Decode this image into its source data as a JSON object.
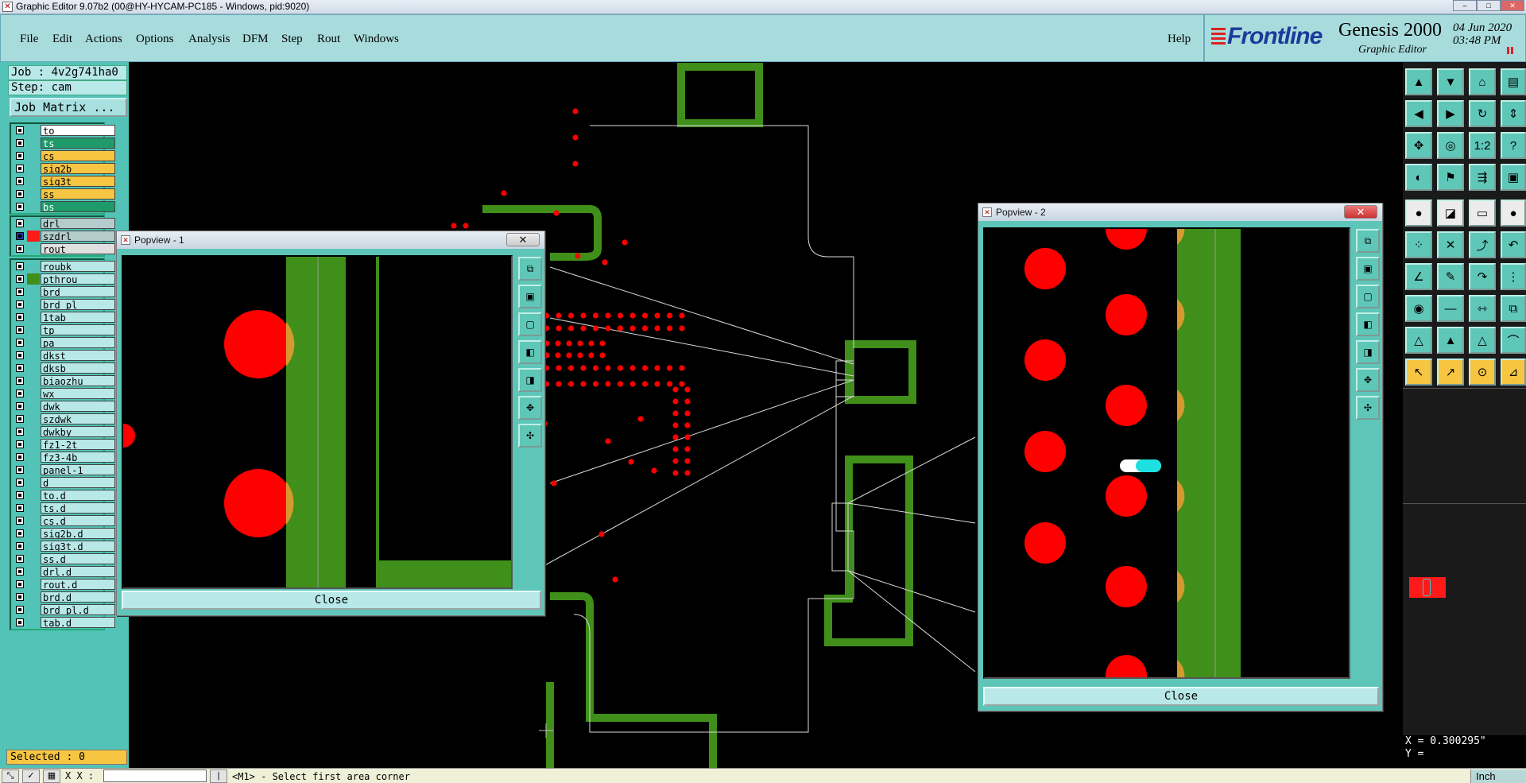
{
  "window": {
    "title": "Graphic Editor 9.07b2 (00@HY-HYCAM-PC185 - Windows, pid:9020)"
  },
  "menu": {
    "items": [
      "File",
      "Edit",
      "Actions",
      "Options",
      "Analysis",
      "DFM",
      "Step",
      "Rout",
      "Windows"
    ],
    "help": "Help"
  },
  "brand": {
    "frontline": "Frontline",
    "genesis": "Genesis 2000",
    "graphic_editor": "Graphic Editor",
    "date": "04 Jun 2020",
    "time": "03:48 PM"
  },
  "job": {
    "job_label": "Job : 4v2g741ha0",
    "step_label": "Step: cam",
    "matrix_button": "Job Matrix ..."
  },
  "layers": {
    "group1": [
      {
        "name": "to",
        "color": "#ffffff"
      },
      {
        "name": "ts",
        "color": "#1f9a6a"
      },
      {
        "name": "cs",
        "color": "#f6c542"
      },
      {
        "name": "sig2b",
        "color": "#f6c542"
      },
      {
        "name": "sig3t",
        "color": "#f6c542"
      },
      {
        "name": "ss",
        "color": "#f6c542"
      },
      {
        "name": "bs",
        "color": "#1f9a6a"
      }
    ],
    "group2": [
      {
        "name": "drl",
        "color": "#b4cccc"
      },
      {
        "name": "szdrl",
        "color": "#b4cccc"
      },
      {
        "name": "rout",
        "color": "#e0e0e0"
      }
    ],
    "group3": [
      "roubk",
      "pthrou",
      "brd",
      "brd_pl",
      "1tab",
      "tp",
      "pa",
      "dkst",
      "dksb",
      "biaozhu",
      "wx",
      "dwk",
      "szdwk",
      "dwkby",
      "fz1-2t",
      "fz3-4b",
      "panel-1",
      "d",
      "to.d",
      "ts.d",
      "cs.d",
      "sig2b.d",
      "sig3t.d",
      "ss.d",
      "drl.d",
      "rout.d",
      "brd.d",
      "brd_pl.d",
      "tab.d"
    ]
  },
  "status": {
    "selected": "Selected : 0",
    "prompt": "<M1> - Select first area corner",
    "x_label": "X X :"
  },
  "coordinates": {
    "x": "X = 0.300295\"",
    "y": "Y = "
  },
  "units": "Inch",
  "popview1": {
    "title": "Popview - 1",
    "close": "Close"
  },
  "popview2": {
    "title": "Popview - 2",
    "close": "Close"
  },
  "colors": {
    "copper": "#3f8f1a",
    "pad": "#ff0000",
    "panel": "#52c3b6",
    "menu": "#a8dcdc",
    "accent": "#f6c542"
  },
  "toolbar_icons": [
    "zoom-in-icon",
    "zoom-out-icon",
    "home-icon",
    "layout-icon",
    "pan-left-icon",
    "pan-right-icon",
    "redraw-icon",
    "stretch-icon",
    "fit-icon",
    "center-icon",
    "ratio-icon",
    "help-icon",
    "snap-icon",
    "route-icon",
    "net-icon",
    "measure-icon",
    "select-icon",
    "box-icon",
    "ruler-icon",
    "dot-icon",
    "connect-icon",
    "cut-icon",
    "move-icon",
    "arc-icon",
    "line-icon",
    "pencil-icon",
    "rotate-icon",
    "grid-icon",
    "pad-icon",
    "trace-icon",
    "align-icon",
    "group-icon",
    "triangle-icon",
    "arrow-icon",
    "cursor-icon",
    "pick-icon",
    "measure2-icon",
    "step-icon"
  ],
  "ratio_label": "1:2"
}
